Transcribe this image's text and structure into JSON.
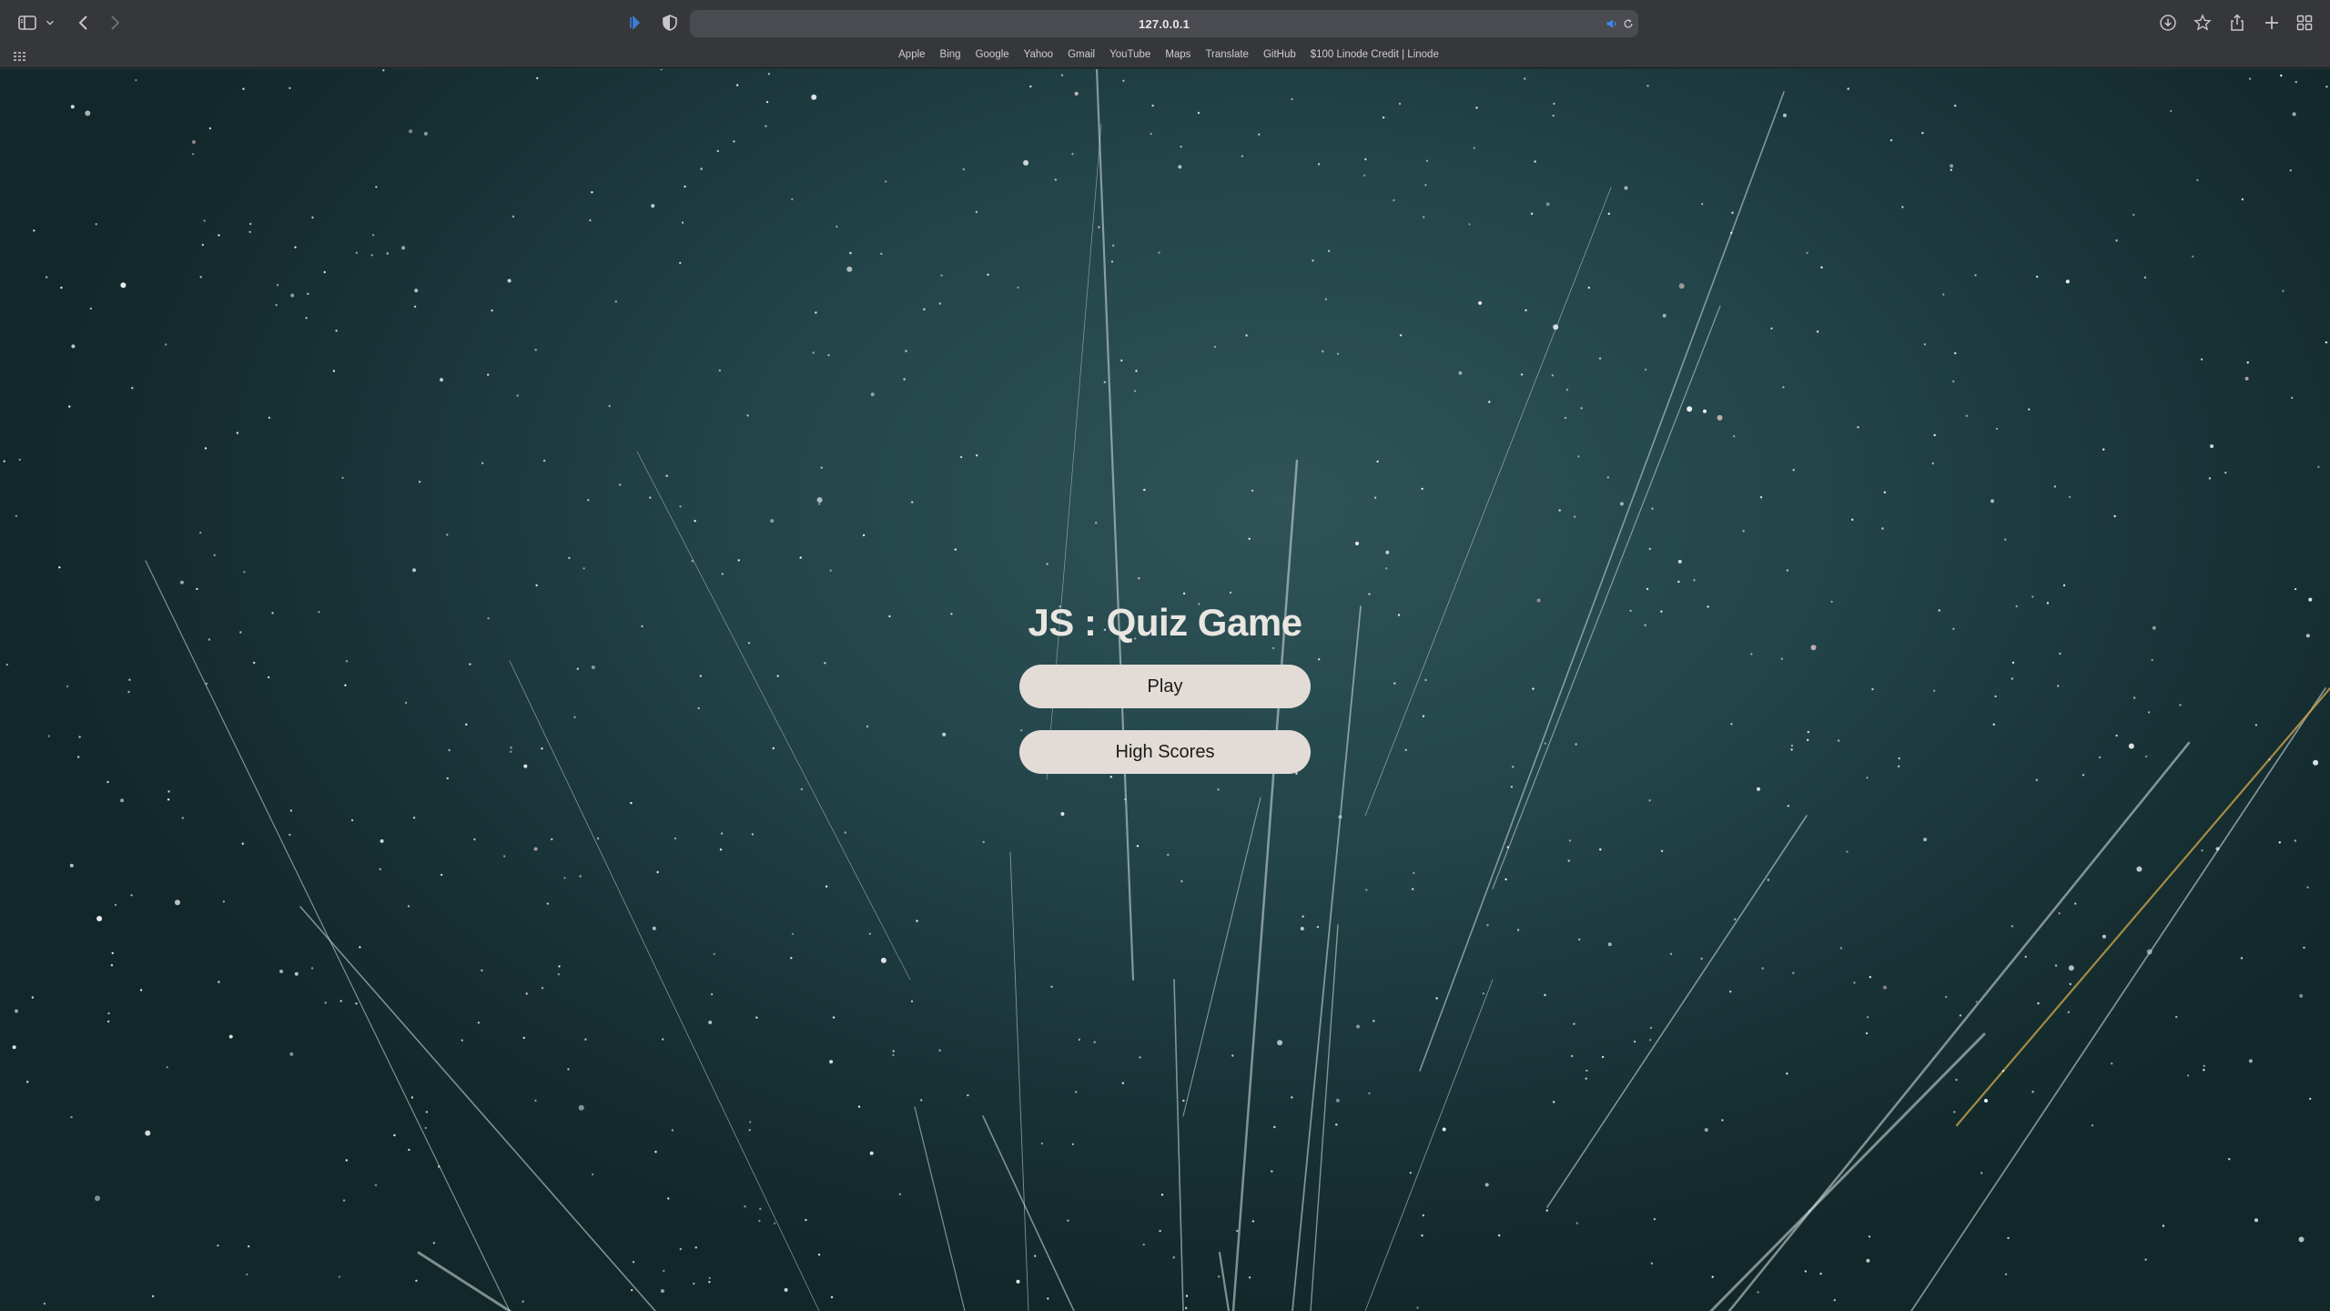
{
  "browser": {
    "url": "127.0.0.1",
    "favorites": [
      "Apple",
      "Bing",
      "Google",
      "Yahoo",
      "Gmail",
      "YouTube",
      "Maps",
      "Translate",
      "GitHub",
      "$100 Linode Credit | Linode"
    ],
    "icons": {
      "sidebar": "sidebar-toggle-icon",
      "back": "chevron-left-icon",
      "forward": "chevron-right-icon",
      "extension": "extension-icon",
      "privacy": "shield-icon",
      "audio": "speaker-icon",
      "reload": "reload-icon",
      "downloads": "download-icon",
      "bookmark": "star-icon",
      "share": "share-icon",
      "newtab": "plus-icon",
      "tabs": "tab-overview-icon"
    }
  },
  "game": {
    "title": "JS : Quiz Game",
    "play_label": "Play",
    "highscores_label": "High Scores"
  },
  "colors": {
    "chrome": "#36373b",
    "button_bg": "#e2dbd6",
    "title_text": "#e9e6e2",
    "accent_blue": "#4a90e2"
  }
}
